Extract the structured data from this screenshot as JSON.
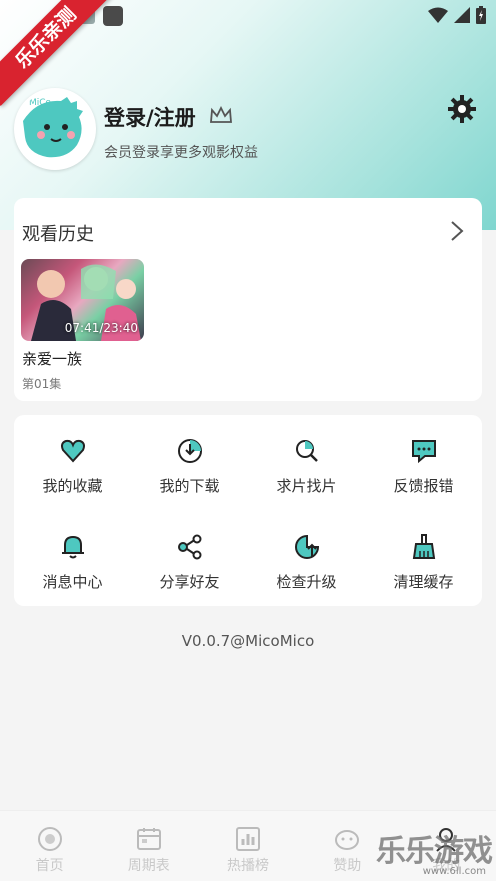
{
  "corner_ribbon": "乐乐亲测",
  "profile": {
    "title": "登录/注册",
    "subtitle": "会员登录享更多观影权益",
    "avatar_text": "MiCo"
  },
  "history": {
    "title": "观看历史",
    "items": [
      {
        "time": "07:41/23:40",
        "title": "亲爱一族",
        "episode": "第01集"
      }
    ]
  },
  "menu": [
    {
      "label": "我的收藏",
      "icon": "heart-icon"
    },
    {
      "label": "我的下载",
      "icon": "download-icon"
    },
    {
      "label": "求片找片",
      "icon": "search-movie-icon"
    },
    {
      "label": "反馈报错",
      "icon": "feedback-icon"
    },
    {
      "label": "消息中心",
      "icon": "bell-icon"
    },
    {
      "label": "分享好友",
      "icon": "share-icon"
    },
    {
      "label": "检查升级",
      "icon": "upgrade-icon"
    },
    {
      "label": "清理缓存",
      "icon": "broom-icon"
    }
  ],
  "version": "V0.0.7@MicoMico",
  "tabs": [
    {
      "label": "首页",
      "icon": "home-icon"
    },
    {
      "label": "周期表",
      "icon": "calendar-icon"
    },
    {
      "label": "热播榜",
      "icon": "chart-icon"
    },
    {
      "label": "赞助",
      "icon": "sponsor-icon"
    },
    {
      "label": "我的",
      "icon": "me-icon"
    }
  ],
  "watermark": "乐乐游戏",
  "watermark_url": "www.6ll.com",
  "colors": {
    "accent": "#4ec8c0",
    "ribbon": "#d9232f"
  }
}
